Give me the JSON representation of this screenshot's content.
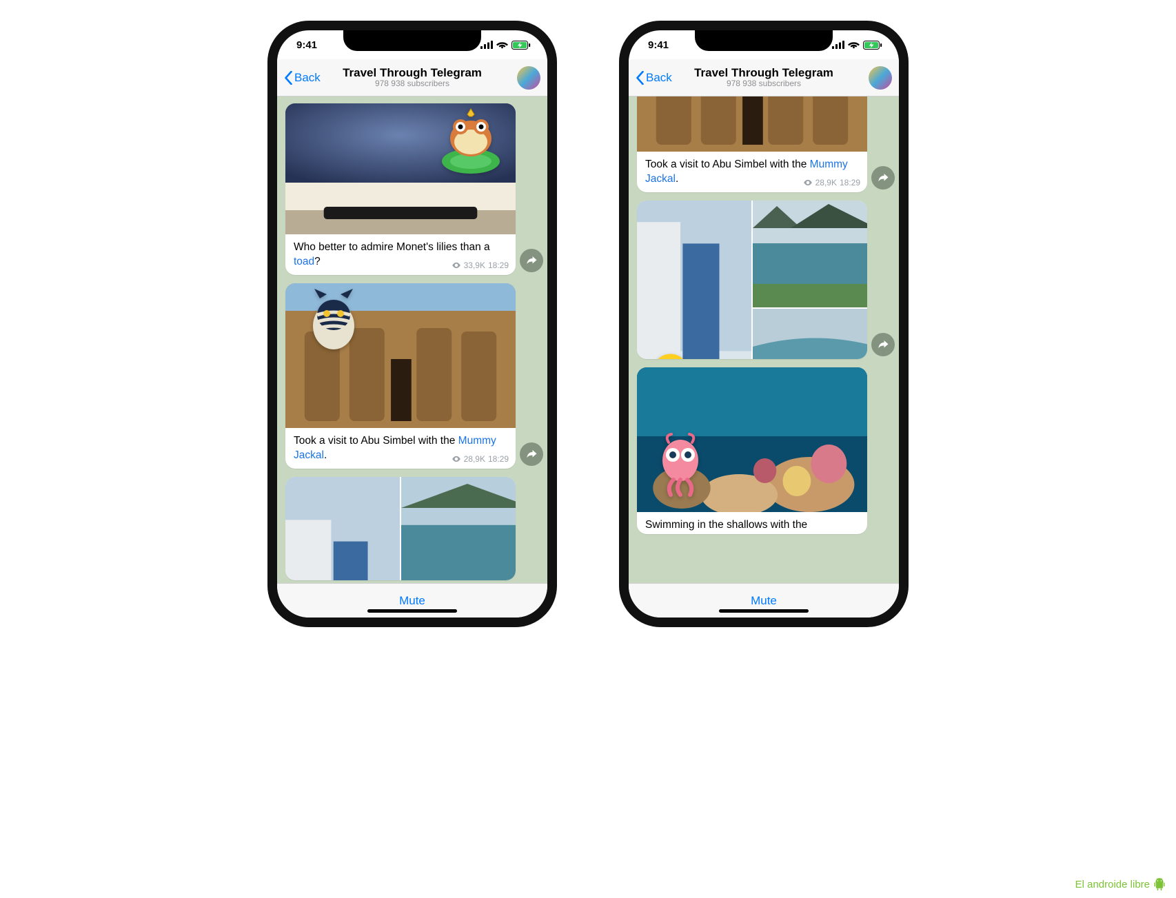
{
  "status": {
    "time": "9:41"
  },
  "header": {
    "back": "Back",
    "title": "Travel Through Telegram",
    "subscribers": "978 938 subscribers"
  },
  "footer": {
    "mute": "Mute"
  },
  "phoneA": {
    "msg1": {
      "caption_before": "Who better to admire Monet's lilies than a ",
      "caption_link": "toad",
      "caption_after": "?",
      "views": "33,9K",
      "time": "18:29"
    },
    "msg2": {
      "caption_before": "Took a visit to Abu Simbel with the ",
      "caption_link": "Mummy Jackal",
      "caption_after": ".",
      "views": "28,9K",
      "time": "18:29"
    }
  },
  "phoneB": {
    "msg1": {
      "caption_before": "Took a visit to Abu Simbel with the ",
      "caption_link": "Mummy Jackal",
      "caption_after": ".",
      "views": "28,9K",
      "time": "18:29"
    },
    "msg3": {
      "caption_partial": "Swimming in the shallows with the"
    }
  },
  "watermark": "El androide libre"
}
